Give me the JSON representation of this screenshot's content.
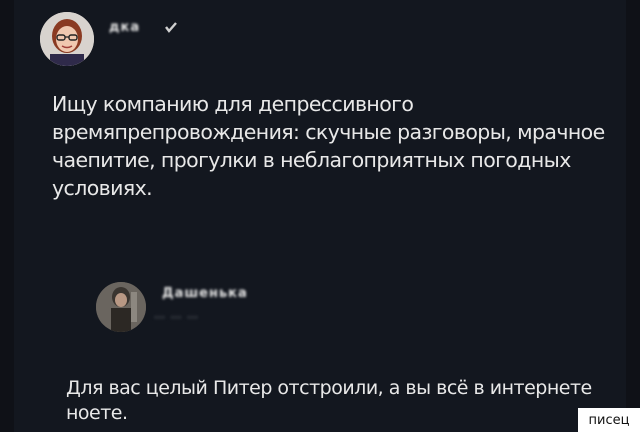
{
  "post": {
    "author_handle": "дка",
    "text": "Ищу компанию для депрессивного времяпрепровождения: скучные разговоры, мрачное чаепитие, прогулки в неблагоприятных погодных условиях."
  },
  "reply": {
    "author_handle": "Дашенька",
    "author_subline": "… … …",
    "text": "Для вас целый Питер отстроили, а вы всё в интернете ноете."
  },
  "watermark": {
    "text": "писец"
  },
  "colors": {
    "background": "#13171f",
    "text": "#e8e8e8"
  },
  "icons": [
    "verified-badge-icon"
  ]
}
